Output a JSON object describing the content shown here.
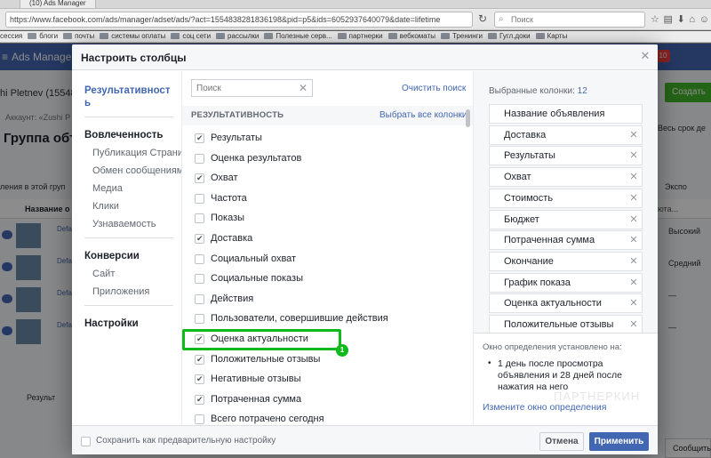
{
  "browser": {
    "tab_title": "(10) Ads Manager",
    "url": "https://www.facebook.com/ads/manager/adset/ads/?act=1554838281836198&pid=p5&ids=6052937640079&date=lifetime",
    "search_placeholder": "Поиск",
    "bookmarks": [
      "сессия",
      "блоги",
      "почты",
      "системы оплаты",
      "соц сети",
      "рассылки",
      "Полезные серв...",
      "партнерки",
      "вебкоматы",
      "Тренинги",
      "Гугл.доки",
      "Карты"
    ]
  },
  "background": {
    "app_title": "Ads Manager",
    "notif_count": "10",
    "account": "hi Pletnev (1554838",
    "account_sub": "Аккаунт: «Zushi P",
    "page_heading": "Группа объ",
    "create_button": "Создать",
    "right_filter": "Весь срок де",
    "left_row": "ления в этой груп",
    "right_row": "Экспо",
    "table_col_name": "Название о",
    "table_col_right": "юта...",
    "row_prefix": "Defa",
    "row_values": [
      "Высокий",
      "Средний",
      "—",
      "—"
    ],
    "footer_left": "Результ",
    "footer_right": "Сообщить"
  },
  "modal": {
    "title": "Настроить столбцы",
    "nav": {
      "selected": "Результативность",
      "engagement_heading": "Вовлеченность",
      "engagement_items": [
        "Публикация Страни",
        "Обмен сообщениями",
        "Медиа",
        "Клики",
        "Узнаваемость"
      ],
      "conversions_heading": "Конверсии",
      "conversions_items": [
        "Сайт",
        "Приложения"
      ],
      "settings_heading": "Настройки"
    },
    "search_placeholder": "Поиск",
    "clear_search": "Очистить поиск",
    "section_title": "РЕЗУЛЬТАТИВНОСТЬ",
    "select_all": "Выбрать все колонки",
    "options": [
      {
        "label": "Результаты",
        "checked": true
      },
      {
        "label": "Оценка результатов",
        "checked": false
      },
      {
        "label": "Охват",
        "checked": true
      },
      {
        "label": "Частота",
        "checked": false
      },
      {
        "label": "Показы",
        "checked": false
      },
      {
        "label": "Доставка",
        "checked": true
      },
      {
        "label": "Социальный охват",
        "checked": false
      },
      {
        "label": "Социальные показы",
        "checked": false
      },
      {
        "label": "Действия",
        "checked": false
      },
      {
        "label": "Пользователи, совершившие действия",
        "checked": false
      },
      {
        "label": "Оценка актуальности",
        "checked": true
      },
      {
        "label": "Положительные отзывы",
        "checked": true
      },
      {
        "label": "Негативные отзывы",
        "checked": true
      },
      {
        "label": "Потраченная сумма",
        "checked": true
      },
      {
        "label": "Всего потрачено сегодня",
        "checked": false
      }
    ],
    "highlight_badge": "1",
    "selected_label": "Выбранные колонки:",
    "selected_count": "12",
    "selected_columns": [
      "Название объявления",
      "Доставка",
      "Результаты",
      "Охват",
      "Стоимость",
      "Бюджет",
      "Потраченная сумма",
      "Окончание",
      "График показа",
      "Оценка актуальности",
      "Положительные отзывы"
    ],
    "attribution_title": "Окно определения установлено на:",
    "attribution_bullet": "•",
    "attribution_text": "1 день после просмотра объявления и 28 дней после нажатия на него",
    "attribution_link": "Измените окно определения",
    "watermark": "ПАРТНЕРКИН",
    "save_preset": "Сохранить как предварительную настройку",
    "cancel": "Отмена",
    "apply": "Применить"
  },
  "colors": {
    "accent": "#4267b2",
    "highlight": "#10b91c"
  },
  "icons": {
    "close": "close-icon",
    "remove": "remove-icon",
    "checkmark": "checkmark-icon",
    "search": "search-icon"
  }
}
